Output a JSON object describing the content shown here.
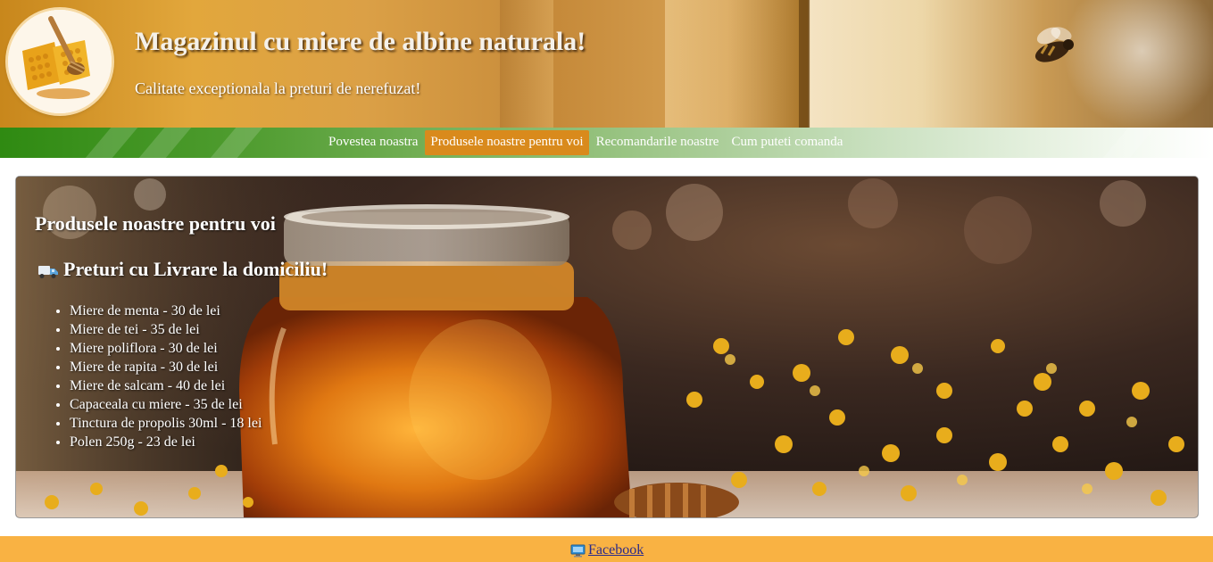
{
  "header": {
    "title": "Magazinul cu miere de albine naturala!",
    "tagline": "Calitate exceptionala la preturi de nerefuzat!",
    "logo_icon": "honeycomb-logo-icon",
    "bee_icon": "bee-icon"
  },
  "nav": {
    "items": [
      {
        "label": "Povestea noastra",
        "active": false
      },
      {
        "label": "Produsele noastre pentru voi",
        "active": true
      },
      {
        "label": "Recomandarile noastre",
        "active": false
      },
      {
        "label": "Cum puteti comanda",
        "active": false
      }
    ],
    "active_color": "#d98a1c"
  },
  "main": {
    "heading": "Produsele noastre pentru voi",
    "subheading": "Preturi cu Livrare la domiciliu!",
    "subheading_icon": "truck-icon",
    "products": [
      "Miere de menta - 30 de lei",
      "Miere de tei - 35 de lei",
      "Miere poliflora - 30 de lei",
      "Miere de rapita - 30 de lei",
      "Miere de salcam - 40 de lei",
      "Capaceala cu miere - 35 de lei",
      "Tinctura de propolis 30ml - 18 lei",
      "Polen 250g - 23 de lei"
    ]
  },
  "footer": {
    "link_label": "Facebook",
    "link_icon": "monitor-icon",
    "background": "#f9b243"
  },
  "colors": {
    "nav_green": "#2f8a12",
    "footer_orange": "#f9b243",
    "honey": "#e08a1e"
  }
}
